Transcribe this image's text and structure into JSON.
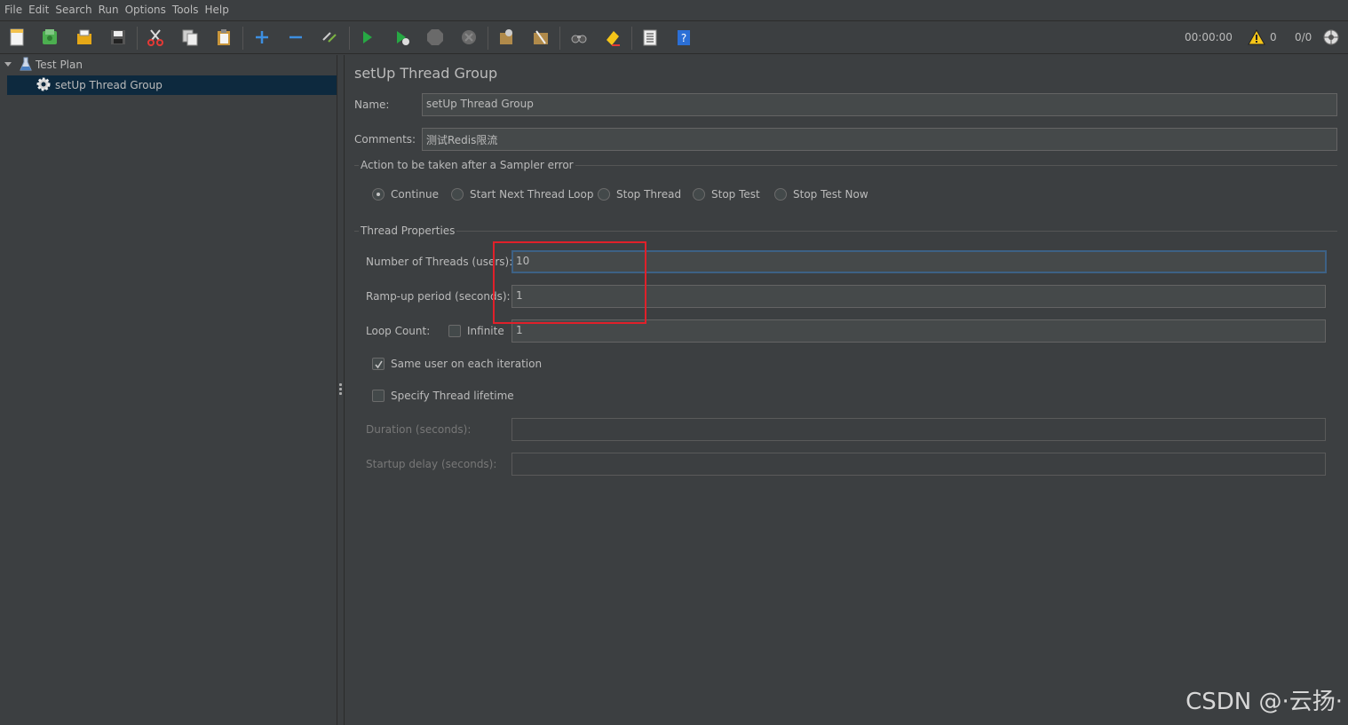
{
  "menu": {
    "file": "File",
    "edit": "Edit",
    "search": "Search",
    "run": "Run",
    "options": "Options",
    "tools": "Tools",
    "help": "Help"
  },
  "toolbar": {
    "icons": [
      "new-icon",
      "templates-icon",
      "open-icon",
      "save-icon",
      "cut-icon",
      "copy-icon",
      "paste-icon",
      "expand-icon",
      "collapse-icon",
      "toggle-icon",
      "start-icon",
      "start-no-timers-icon",
      "stop-icon",
      "shutdown-icon",
      "clear-icon",
      "clear-all-icon",
      "search-icon",
      "reset-search-icon",
      "function-helper-icon",
      "help-icon"
    ],
    "timer": "00:00:00",
    "warnings": "0",
    "threads": "0/0"
  },
  "tree": {
    "root": "Test Plan",
    "child": "setUp Thread Group"
  },
  "panel": {
    "title": "setUp Thread Group",
    "name_label": "Name:",
    "name_value": "setUp Thread Group",
    "comments_label": "Comments:",
    "comments_value": "测试Redis限流",
    "action_group_title": "Action to be taken after a Sampler error",
    "actions": {
      "continue": "Continue",
      "next_loop": "Start Next Thread Loop",
      "stop_thread": "Stop Thread",
      "stop_test": "Stop Test",
      "stop_test_now": "Stop Test Now"
    },
    "selected_action": "Continue",
    "thread_props_title": "Thread Properties",
    "threads_label": "Number of Threads (users):",
    "threads_value": "10",
    "rampup_label": "Ramp-up period (seconds):",
    "rampup_value": "1",
    "loop_label": "Loop Count:",
    "infinite_label": "Infinite",
    "infinite_checked": false,
    "loop_value": "1",
    "same_user_label": "Same user on each iteration",
    "same_user_checked": true,
    "lifetime_label": "Specify Thread lifetime",
    "lifetime_checked": false,
    "duration_label": "Duration (seconds):",
    "duration_value": "",
    "startup_label": "Startup delay (seconds):",
    "startup_value": ""
  },
  "watermark": "CSDN @·云扬·",
  "colors": {
    "background": "#3c3f41",
    "selection": "#0d293e",
    "highlight": "#e0202a",
    "focus_border": "#3d6185"
  }
}
